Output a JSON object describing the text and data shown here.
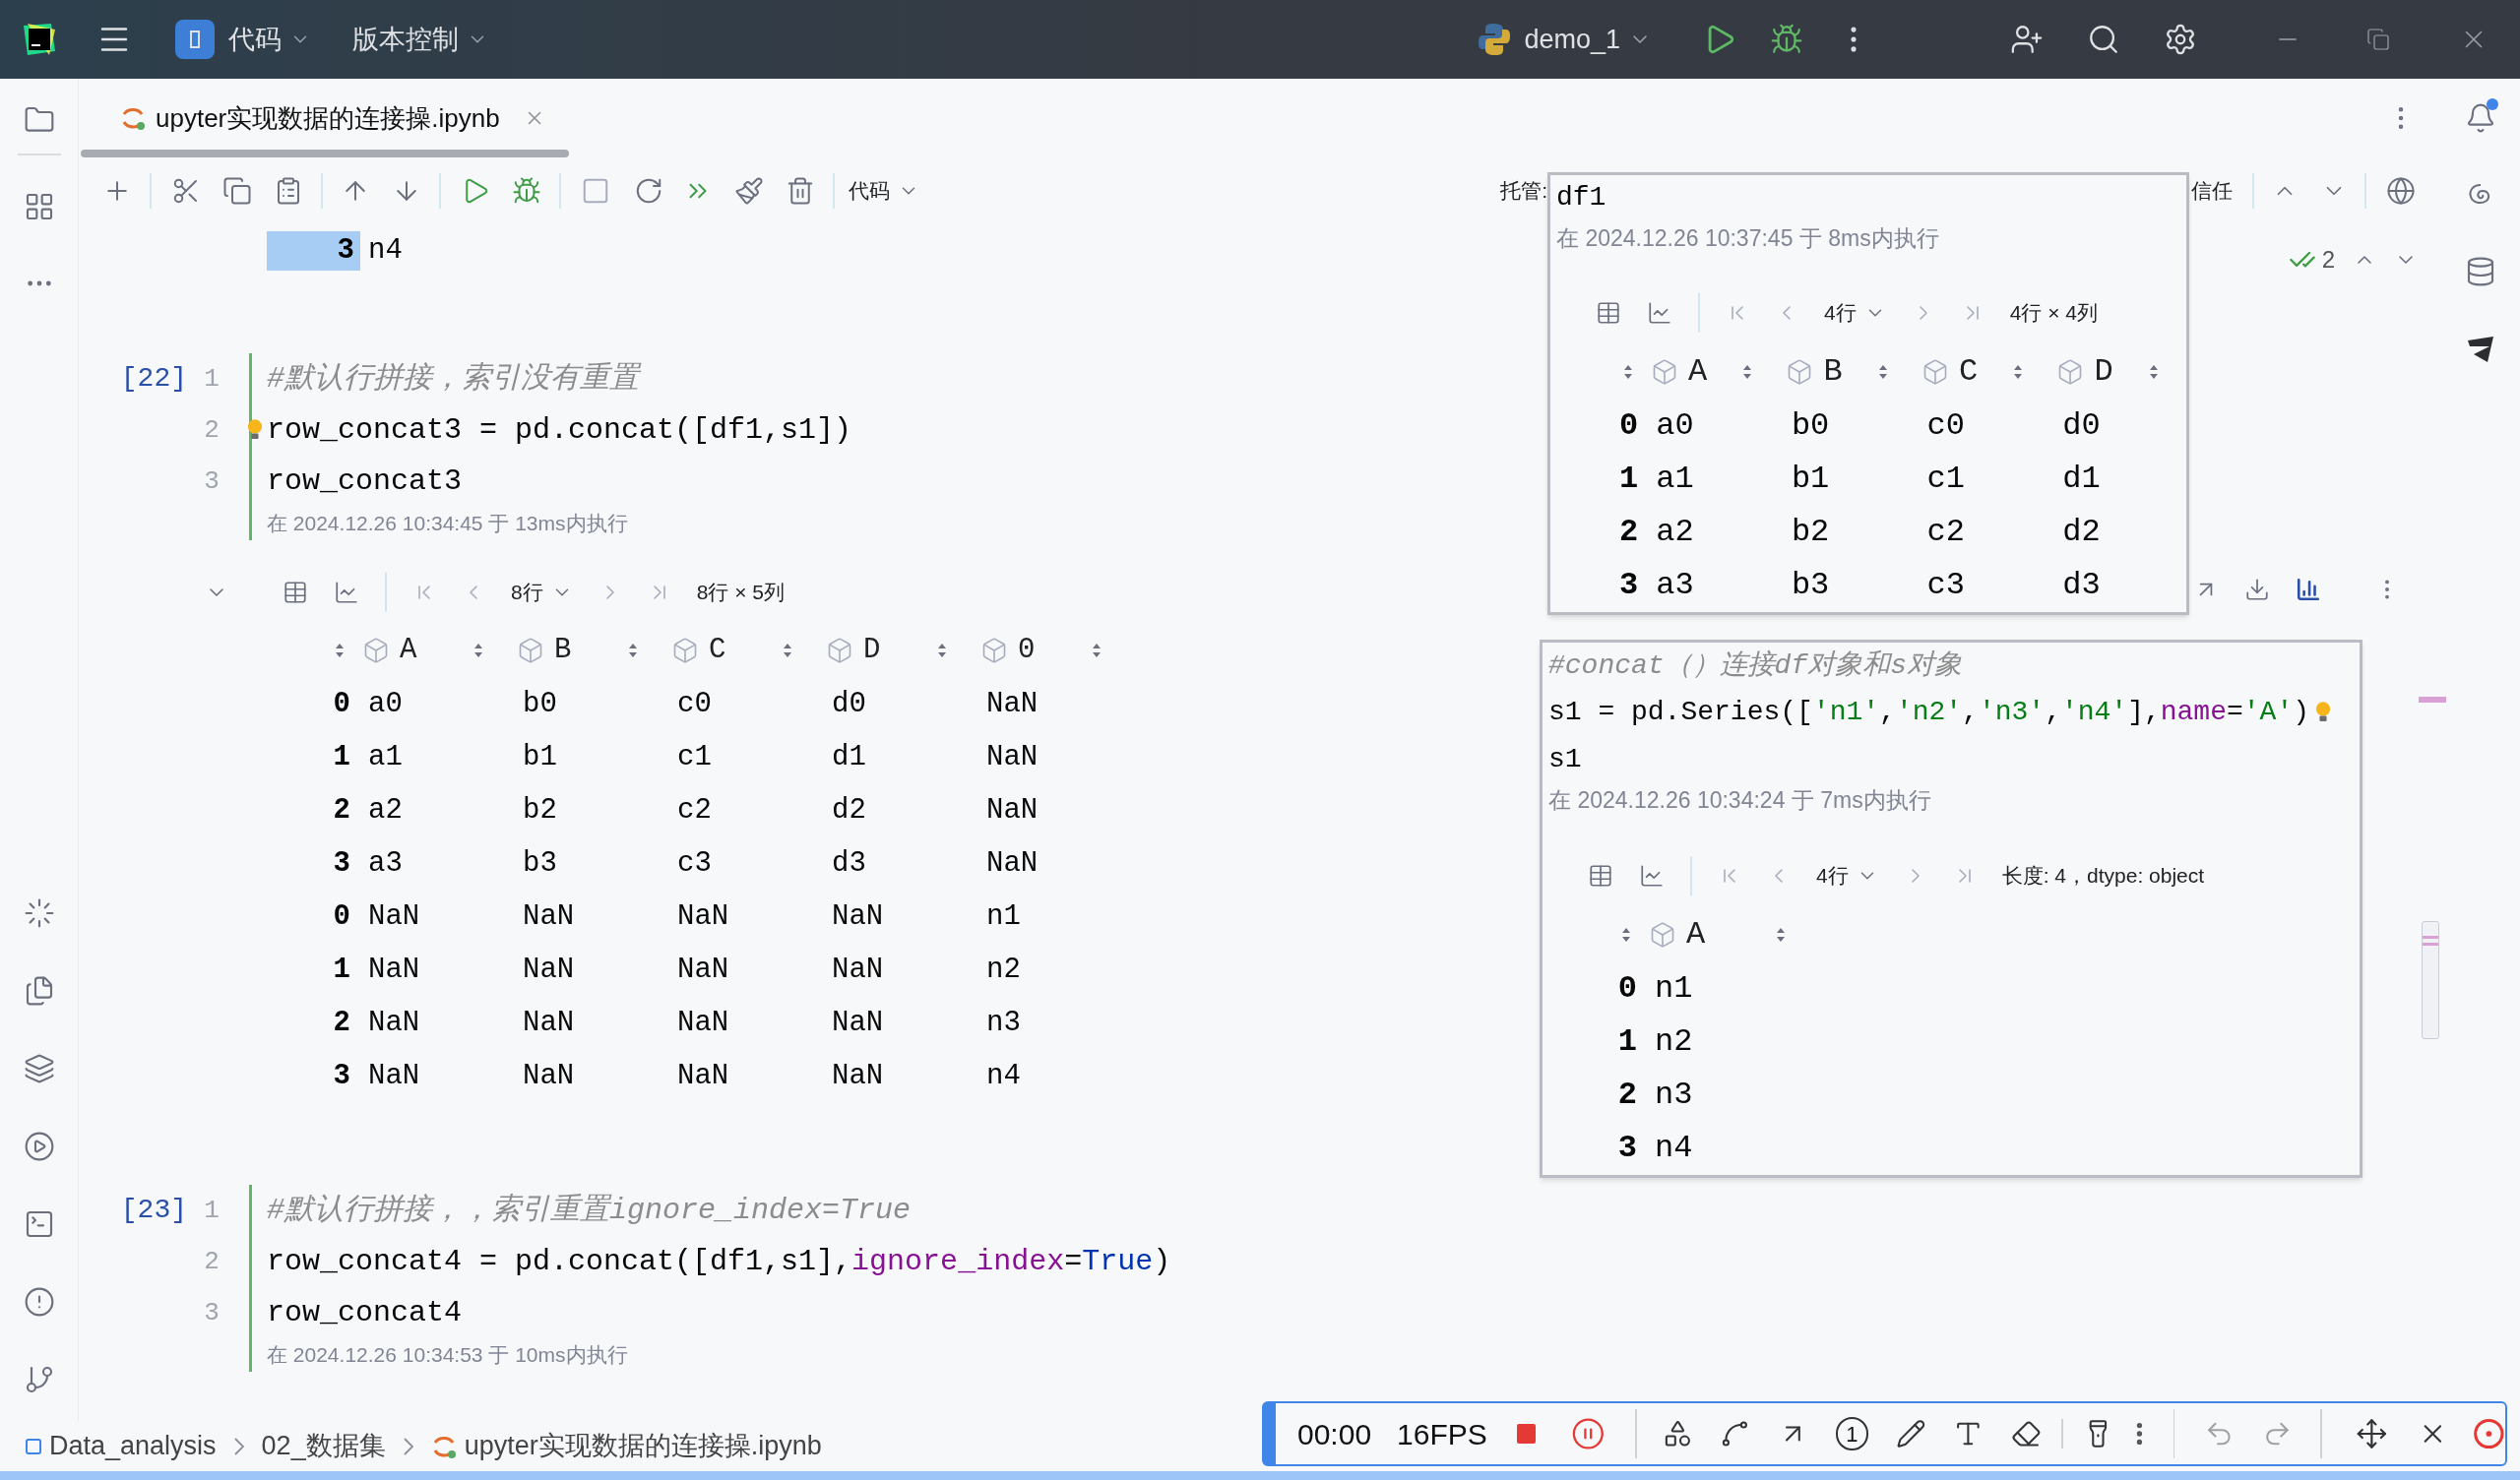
{
  "title_bar": {
    "menus": [
      {
        "label": "代码"
      },
      {
        "label": "版本控制"
      }
    ],
    "run_config": "demo_1"
  },
  "editor_tab": {
    "label": "upyter实现数据的连接操.ipynb",
    "selected": true
  },
  "toolbar": {
    "cell_type": "代码",
    "managed_label": "托管:",
    "trust_label": "信任"
  },
  "inspections": {
    "count": "2"
  },
  "top_output": {
    "rows": [
      {
        "index": "3",
        "value": "n4",
        "selected": true
      }
    ]
  },
  "cells": [
    {
      "exec": "[22]",
      "timestamp": "在 2024.12.26 10:34:45 于 13ms内执行",
      "lines": [
        {
          "number": "1",
          "hint": false,
          "tokens": [
            {
              "kind": "comment",
              "text": "#默认行拼接，索引没有重置"
            }
          ]
        },
        {
          "number": "2",
          "hint": true,
          "tokens": [
            {
              "kind": "plain",
              "text": "row_concat3 = pd.concat([df1,s1])"
            }
          ]
        },
        {
          "number": "3",
          "hint": false,
          "tokens": [
            {
              "kind": "plain",
              "text": "row_concat3"
            }
          ]
        }
      ],
      "output": {
        "page": "8行",
        "info": "8行 × 5列",
        "columns": [
          "A",
          "B",
          "C",
          "D",
          "0"
        ],
        "rows": [
          {
            "index": "0",
            "values": [
              "a0",
              "b0",
              "c0",
              "d0",
              "NaN"
            ]
          },
          {
            "index": "1",
            "values": [
              "a1",
              "b1",
              "c1",
              "d1",
              "NaN"
            ]
          },
          {
            "index": "2",
            "values": [
              "a2",
              "b2",
              "c2",
              "d2",
              "NaN"
            ]
          },
          {
            "index": "3",
            "values": [
              "a3",
              "b3",
              "c3",
              "d3",
              "NaN"
            ]
          },
          {
            "index": "0",
            "values": [
              "NaN",
              "NaN",
              "NaN",
              "NaN",
              "n1"
            ]
          },
          {
            "index": "1",
            "values": [
              "NaN",
              "NaN",
              "NaN",
              "NaN",
              "n2"
            ]
          },
          {
            "index": "2",
            "values": [
              "NaN",
              "NaN",
              "NaN",
              "NaN",
              "n3"
            ]
          },
          {
            "index": "3",
            "values": [
              "NaN",
              "NaN",
              "NaN",
              "NaN",
              "n4"
            ]
          }
        ]
      }
    },
    {
      "exec": "[23]",
      "timestamp": "在 2024.12.26 10:34:53 于 10ms内执行",
      "lines": [
        {
          "number": "1",
          "hint": false,
          "tokens": [
            {
              "kind": "comment",
              "text": "#默认行拼接，，索引重置ignore_index=True"
            }
          ]
        },
        {
          "number": "2",
          "hint": false,
          "tokens": [
            {
              "kind": "plain",
              "text": "row_concat4 = pd.concat([df1,s1],"
            },
            {
              "kind": "param",
              "text": "ignore_index"
            },
            {
              "kind": "plain",
              "text": "="
            },
            {
              "kind": "keyword",
              "text": "True"
            },
            {
              "kind": "plain",
              "text": ")"
            }
          ]
        },
        {
          "number": "3",
          "hint": false,
          "tokens": [
            {
              "kind": "plain",
              "text": "row_concat4"
            }
          ]
        }
      ]
    }
  ],
  "preview_popups": [
    {
      "timestamp": "在 2024.12.26 10:37:45 于 8ms内执行",
      "lines": [
        {
          "hint": false,
          "tokens": [
            {
              "kind": "plain",
              "text": "df1"
            }
          ]
        }
      ],
      "output": {
        "page": "4行",
        "info": "4行 × 4列",
        "columns": [
          "A",
          "B",
          "C",
          "D"
        ],
        "rows": [
          {
            "index": "0",
            "values": [
              "a0",
              "b0",
              "c0",
              "d0"
            ]
          },
          {
            "index": "1",
            "values": [
              "a1",
              "b1",
              "c1",
              "d1"
            ]
          },
          {
            "index": "2",
            "values": [
              "a2",
              "b2",
              "c2",
              "d2"
            ]
          },
          {
            "index": "3",
            "values": [
              "a3",
              "b3",
              "c3",
              "d3"
            ]
          }
        ]
      }
    },
    {
      "timestamp": "在 2024.12.26 10:34:24 于 7ms内执行",
      "lines": [
        {
          "hint": false,
          "tokens": [
            {
              "kind": "comment",
              "text": "#concat（）连接df对象和s对象"
            }
          ]
        },
        {
          "hint": true,
          "tokens": [
            {
              "kind": "plain",
              "text": "s1 = pd.Series(["
            },
            {
              "kind": "string",
              "text": "'n1'"
            },
            {
              "kind": "plain",
              "text": ","
            },
            {
              "kind": "string",
              "text": "'n2'"
            },
            {
              "kind": "plain",
              "text": ","
            },
            {
              "kind": "string",
              "text": "'n3'"
            },
            {
              "kind": "plain",
              "text": ","
            },
            {
              "kind": "string",
              "text": "'n4'"
            },
            {
              "kind": "plain",
              "text": "],"
            },
            {
              "kind": "param",
              "text": "name"
            },
            {
              "kind": "plain",
              "text": "="
            },
            {
              "kind": "string",
              "text": "'A'"
            },
            {
              "kind": "plain",
              "text": ")"
            }
          ]
        },
        {
          "hint": false,
          "tokens": [
            {
              "kind": "plain",
              "text": "s1"
            }
          ]
        }
      ],
      "output": {
        "page": "4行",
        "info": "长度: 4，dtype: object",
        "columns": [
          "A"
        ],
        "rows": [
          {
            "index": "0",
            "values": [
              "n1"
            ]
          },
          {
            "index": "1",
            "values": [
              "n2"
            ]
          },
          {
            "index": "2",
            "values": [
              "n3"
            ]
          },
          {
            "index": "3",
            "values": [
              "n4"
            ]
          }
        ]
      }
    }
  ],
  "breadcrumb": [
    {
      "kind": "module",
      "label": "Data_analysis"
    },
    {
      "kind": "folder",
      "label": "02_数据集"
    },
    {
      "kind": "notebook",
      "label": "upyter实现数据的连接操.ipynb"
    }
  ],
  "recorder": {
    "time": "00:00",
    "fps": "16FPS",
    "marker": "1"
  }
}
